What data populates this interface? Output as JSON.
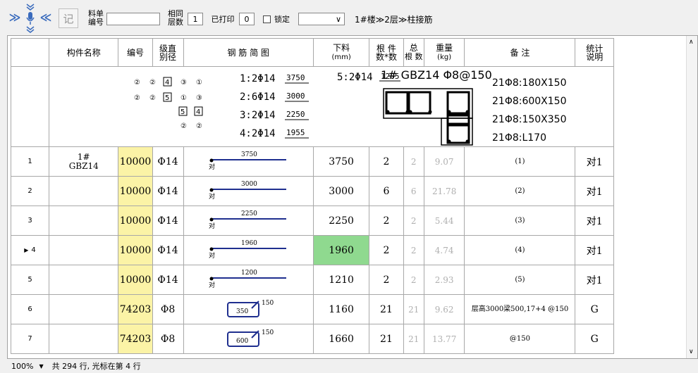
{
  "toolbar": {
    "nav_right": "≫",
    "nav_left": "≪",
    "record_label": "记",
    "material_label_1": "料单",
    "material_label_2": "编号",
    "material_value": "",
    "same_label_1": "相同",
    "same_label_2": "层数",
    "same_value": "1",
    "printed_label": "已打印",
    "printed_value": "0",
    "lock_label": "锁定",
    "dropdown_value": "",
    "breadcrumb": "1#楼≫2层≫柱接筋"
  },
  "header": {
    "col_name": "构件名称",
    "col_no": "编号",
    "col_grade_1": "级直",
    "col_grade_2": "别径",
    "col_sketch": "钢 筋 简 图",
    "col_len_1": "下料",
    "col_len_2": "(mm)",
    "col_roots_1": "根 件",
    "col_roots_2": "数*数",
    "col_total_1": "总",
    "col_total_2": "根 数",
    "col_weight_1": "重量",
    "col_weight_2": "(kg)",
    "col_remark": "备 注",
    "col_stats_1": "统计",
    "col_stats_2": "说明"
  },
  "diagram": {
    "left_grid": [
      [
        "②",
        "②",
        "4",
        "③",
        "①"
      ],
      [
        "②",
        "②",
        "5",
        "①",
        "③"
      ],
      [
        "5",
        "4"
      ],
      [
        "②",
        "②"
      ]
    ],
    "bars": [
      "1:2Φ14",
      "2:6Φ14",
      "3:2Φ14",
      "4:2Φ14"
    ],
    "bar_lens": [
      "3750",
      "3000",
      "2250",
      "1955"
    ],
    "bar5": "5:2Φ14",
    "bar5_len": "1205",
    "title": "1# GBZ14 Φ8@150",
    "stirrups": [
      "21Φ8:180X150",
      "21Φ8:600X150",
      "21Φ8:150X350",
      "21Φ8:L170"
    ]
  },
  "rows": [
    {
      "num": "1",
      "name_1": "1#",
      "name_2": "GBZ14",
      "no": "10000",
      "grade": "Φ14",
      "shape": "bar",
      "len_label": "3750",
      "len": "3750",
      "roots": "2",
      "total": "2",
      "weight": "9.07",
      "remark": "(1)",
      "stats": "对1"
    },
    {
      "num": "2",
      "name_1": "",
      "name_2": "",
      "no": "10000",
      "grade": "Φ14",
      "shape": "bar",
      "len_label": "3000",
      "len": "3000",
      "roots": "6",
      "total": "6",
      "weight": "21.78",
      "remark": "(2)",
      "stats": "对1"
    },
    {
      "num": "3",
      "name_1": "",
      "name_2": "",
      "no": "10000",
      "grade": "Φ14",
      "shape": "bar",
      "len_label": "2250",
      "len": "2250",
      "roots": "2",
      "total": "2",
      "weight": "5.44",
      "remark": "(3)",
      "stats": "对1"
    },
    {
      "num": "4",
      "name_1": "",
      "name_2": "",
      "no": "10000",
      "grade": "Φ14",
      "shape": "bar",
      "len_label": "1960",
      "len": "1960",
      "roots": "2",
      "total": "2",
      "weight": "4.74",
      "remark": "(4)",
      "stats": "对1"
    },
    {
      "num": "5",
      "name_1": "",
      "name_2": "",
      "no": "10000",
      "grade": "Φ14",
      "shape": "bar",
      "len_label": "1200",
      "len": "1210",
      "roots": "2",
      "total": "2",
      "weight": "2.93",
      "remark": "(5)",
      "stats": "对1"
    },
    {
      "num": "6",
      "name_1": "",
      "name_2": "",
      "no": "74203",
      "grade": "Φ8",
      "shape": "stirrup",
      "len_label": "350",
      "hook": "150",
      "len": "1160",
      "roots": "21",
      "total": "21",
      "weight": "9.62",
      "remark": "层高3000梁500,17+4 @150",
      "stats": "G"
    },
    {
      "num": "7",
      "name_1": "",
      "name_2": "",
      "no": "74203",
      "grade": "Φ8",
      "shape": "stirrup",
      "len_label": "600",
      "hook": "150",
      "len": "1660",
      "roots": "21",
      "total": "21",
      "weight": "13.77",
      "remark": "@150",
      "stats": "G"
    }
  ],
  "shape_mark": "对",
  "current_marker": "▶",
  "status": {
    "zoom": "100%",
    "zoom_arrow": "▼",
    "text": "共 294 行, 光标在第 4 行"
  },
  "colors": {
    "yellow": "#fbf3a6",
    "green": "#8fd98f",
    "bar_blue": "#1f2f8f"
  }
}
